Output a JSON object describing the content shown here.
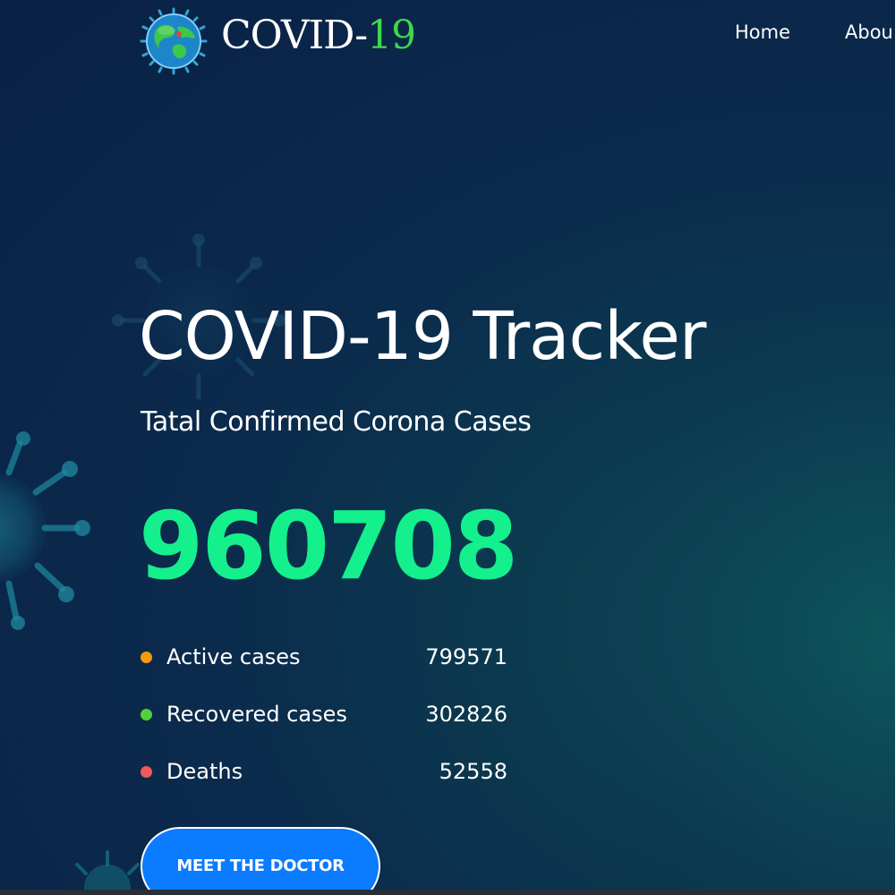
{
  "header": {
    "logo_main": "COVID-",
    "logo_accent": "19",
    "logo_icon": "globe-virus-icon",
    "nav": [
      {
        "label": "Home"
      },
      {
        "label": "Abou"
      }
    ]
  },
  "hero": {
    "title": "COVID-19 Tracker",
    "subtitle": "Tatal Confirmed Corona Cases",
    "total": "960708"
  },
  "stats": [
    {
      "label": "Active cases",
      "value": "799571",
      "color": "#f59a0c"
    },
    {
      "label": "Recovered cases",
      "value": "302826",
      "color": "#52d13a"
    },
    {
      "label": "Deaths",
      "value": "52558",
      "color": "#f05a5a"
    }
  ],
  "cta": {
    "label": "MEET THE DOCTOR"
  },
  "colors": {
    "background": "#0a2146",
    "accent_green": "#14f08c",
    "logo_green": "#3ed84d",
    "button_blue": "#0b7bff"
  }
}
